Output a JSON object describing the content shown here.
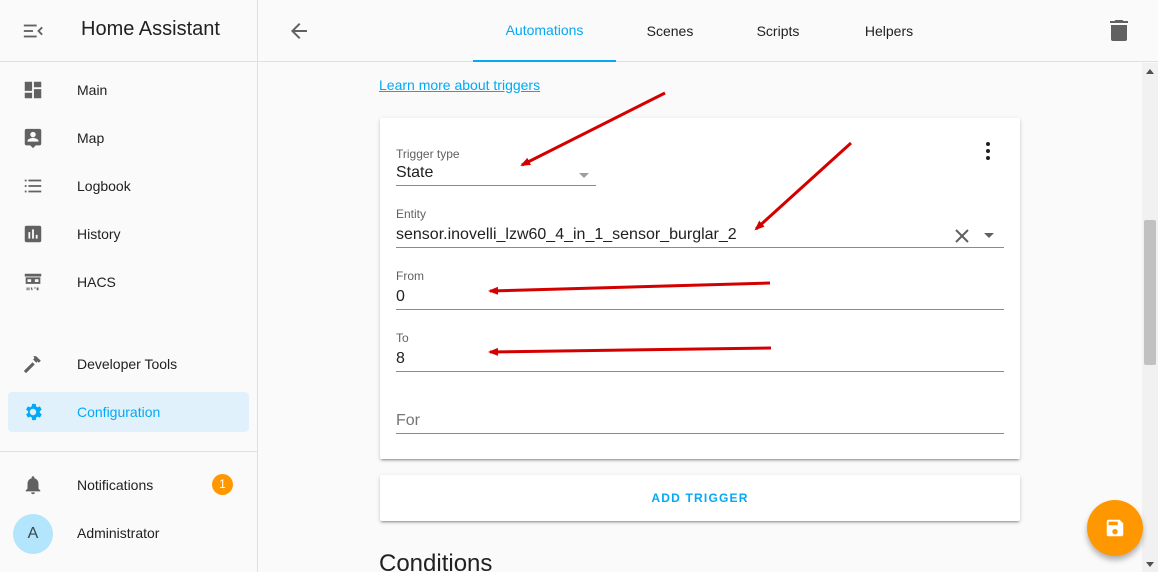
{
  "app": {
    "title": "Home Assistant"
  },
  "sidebar": {
    "items": [
      {
        "label": "Main",
        "icon": "dashboard-icon"
      },
      {
        "label": "Map",
        "icon": "map-icon"
      },
      {
        "label": "Logbook",
        "icon": "logbook-icon"
      },
      {
        "label": "History",
        "icon": "history-icon"
      },
      {
        "label": "HACS",
        "icon": "hacs-icon"
      },
      {
        "label": "Developer Tools",
        "icon": "hammer-icon"
      },
      {
        "label": "Configuration",
        "icon": "gear-icon",
        "active": true
      }
    ],
    "notifications": {
      "label": "Notifications",
      "count": "1"
    },
    "user": {
      "label": "Administrator",
      "initial": "A"
    }
  },
  "toolbar": {
    "tabs": [
      {
        "label": "Automations",
        "active": true
      },
      {
        "label": "Scenes"
      },
      {
        "label": "Scripts"
      },
      {
        "label": "Helpers"
      }
    ]
  },
  "trigger": {
    "learn_link": "Learn more about triggers",
    "type_label": "Trigger type",
    "type_value": "State",
    "entity_label": "Entity",
    "entity_value": "sensor.inovelli_lzw60_4_in_1_sensor_burglar_2",
    "from_label": "From",
    "from_value": "0",
    "to_label": "To",
    "to_value": "8",
    "for_placeholder": "For",
    "add_button": "ADD TRIGGER"
  },
  "conditions": {
    "heading": "Conditions"
  },
  "colors": {
    "accent": "#03a9f4",
    "fab": "#ff9800",
    "annotation": "#e00000"
  }
}
